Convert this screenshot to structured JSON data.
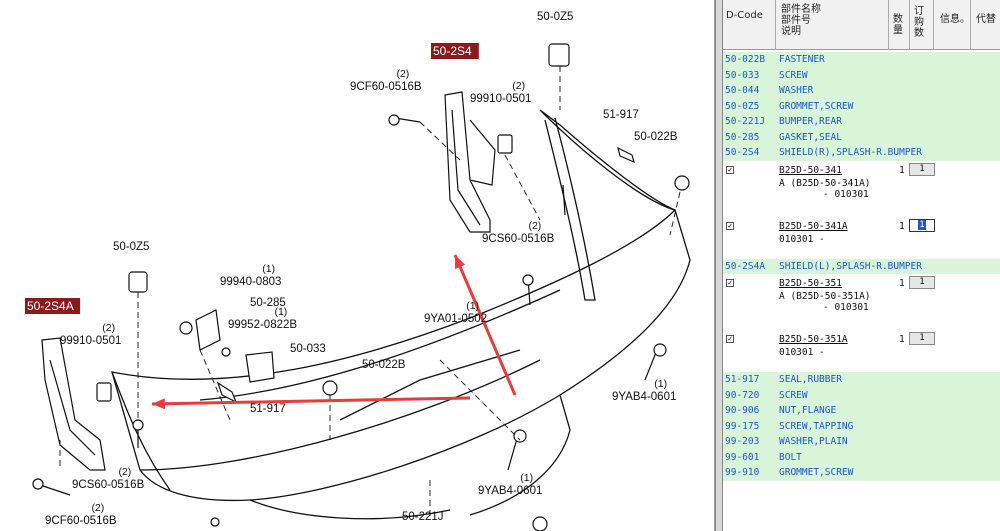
{
  "diagram": {
    "labels": [
      {
        "code": "50-0Z5",
        "qty": ""
      },
      {
        "code": "50-2S4",
        "qty": "",
        "highlight": true
      },
      {
        "code": "9CF60-0516B",
        "qty": "(2)"
      },
      {
        "code": "99910-0501",
        "qty": "(2)"
      },
      {
        "code": "51-917",
        "qty": ""
      },
      {
        "code": "50-022B",
        "qty": ""
      },
      {
        "code": "9CS60-0516B",
        "qty": "(2)"
      },
      {
        "code": "50-0Z5",
        "qty": ""
      },
      {
        "code": "99940-0803",
        "qty": "(1)"
      },
      {
        "code": "50-285",
        "qty": ""
      },
      {
        "code": "99952-0822B",
        "qty": "(1)"
      },
      {
        "code": "50-2S4A",
        "qty": "",
        "highlight": true
      },
      {
        "code": "99910-0501",
        "qty": "(2)"
      },
      {
        "code": "50-033",
        "qty": ""
      },
      {
        "code": "9YA01-0502",
        "qty": "(1)"
      },
      {
        "code": "50-022B",
        "qty": ""
      },
      {
        "code": "51-917",
        "qty": ""
      },
      {
        "code": "9YAB4-0601",
        "qty": "(1)"
      },
      {
        "code": "9CS60-0516B",
        "qty": "(2)"
      },
      {
        "code": "9YAB4-0601",
        "qty": "(1)"
      },
      {
        "code": "9CF60-0516B",
        "qty": "(2)"
      },
      {
        "code": "50-221J",
        "qty": ""
      }
    ],
    "highlight_color": "#8b1a1a",
    "arrow_color": "#e83b3b"
  },
  "parts_table": {
    "headers": {
      "d_code": "D-Code",
      "name_line1": "部件名称",
      "name_line2": "部件号",
      "name_line3": "说明",
      "qty": "数量",
      "order_qty": "订购数",
      "info": "信息。",
      "substitute": "代替"
    },
    "rows": [
      {
        "code": "50-022B",
        "desc": "FASTENER"
      },
      {
        "code": "50-033",
        "desc": "SCREW"
      },
      {
        "code": "50-044",
        "desc": "WASHER"
      },
      {
        "code": "50-0Z5",
        "desc": "GROMMET,SCREW"
      },
      {
        "code": "50-221J",
        "desc": "BUMPER,REAR"
      },
      {
        "code": "50-285",
        "desc": "GASKET,SEAL"
      },
      {
        "code": "50-2S4",
        "desc": "SHIELD(R),SPLASH-R.BUMPER"
      }
    ],
    "sub_2s4": [
      {
        "part": "B25D-50-341",
        "qty": "1",
        "order": "1",
        "line2": "A (B25D-50-341A)",
        "line3": "- 010301",
        "active": false
      },
      {
        "part": "B25D-50-341A",
        "qty": "1",
        "order": "1",
        "line2": "010301  -",
        "line3": "",
        "active": true
      }
    ],
    "row_2s4a": {
      "code": "50-2S4A",
      "desc": "SHIELD(L),SPLASH-R.BUMPER"
    },
    "sub_2s4a": [
      {
        "part": "B25D-50-351",
        "qty": "1",
        "order": "1",
        "line2": "A (B25D-50-351A)",
        "line3": "- 010301",
        "active": false
      },
      {
        "part": "B25D-50-351A",
        "qty": "1",
        "order": "1",
        "line2": "010301  -",
        "line3": "",
        "active": false
      }
    ],
    "rows_tail": [
      {
        "code": "51-917",
        "desc": "SEAL,RUBBER"
      },
      {
        "code": "90-720",
        "desc": "SCREW"
      },
      {
        "code": "90-906",
        "desc": "NUT,FLANGE"
      },
      {
        "code": "99-175",
        "desc": "SCREW,TAPPING"
      },
      {
        "code": "99-203",
        "desc": "WASHER,PLAIN"
      },
      {
        "code": "99-601",
        "desc": "BOLT"
      },
      {
        "code": "99-910",
        "desc": "GROMMET,SCREW"
      }
    ],
    "check_mark": "✓"
  }
}
